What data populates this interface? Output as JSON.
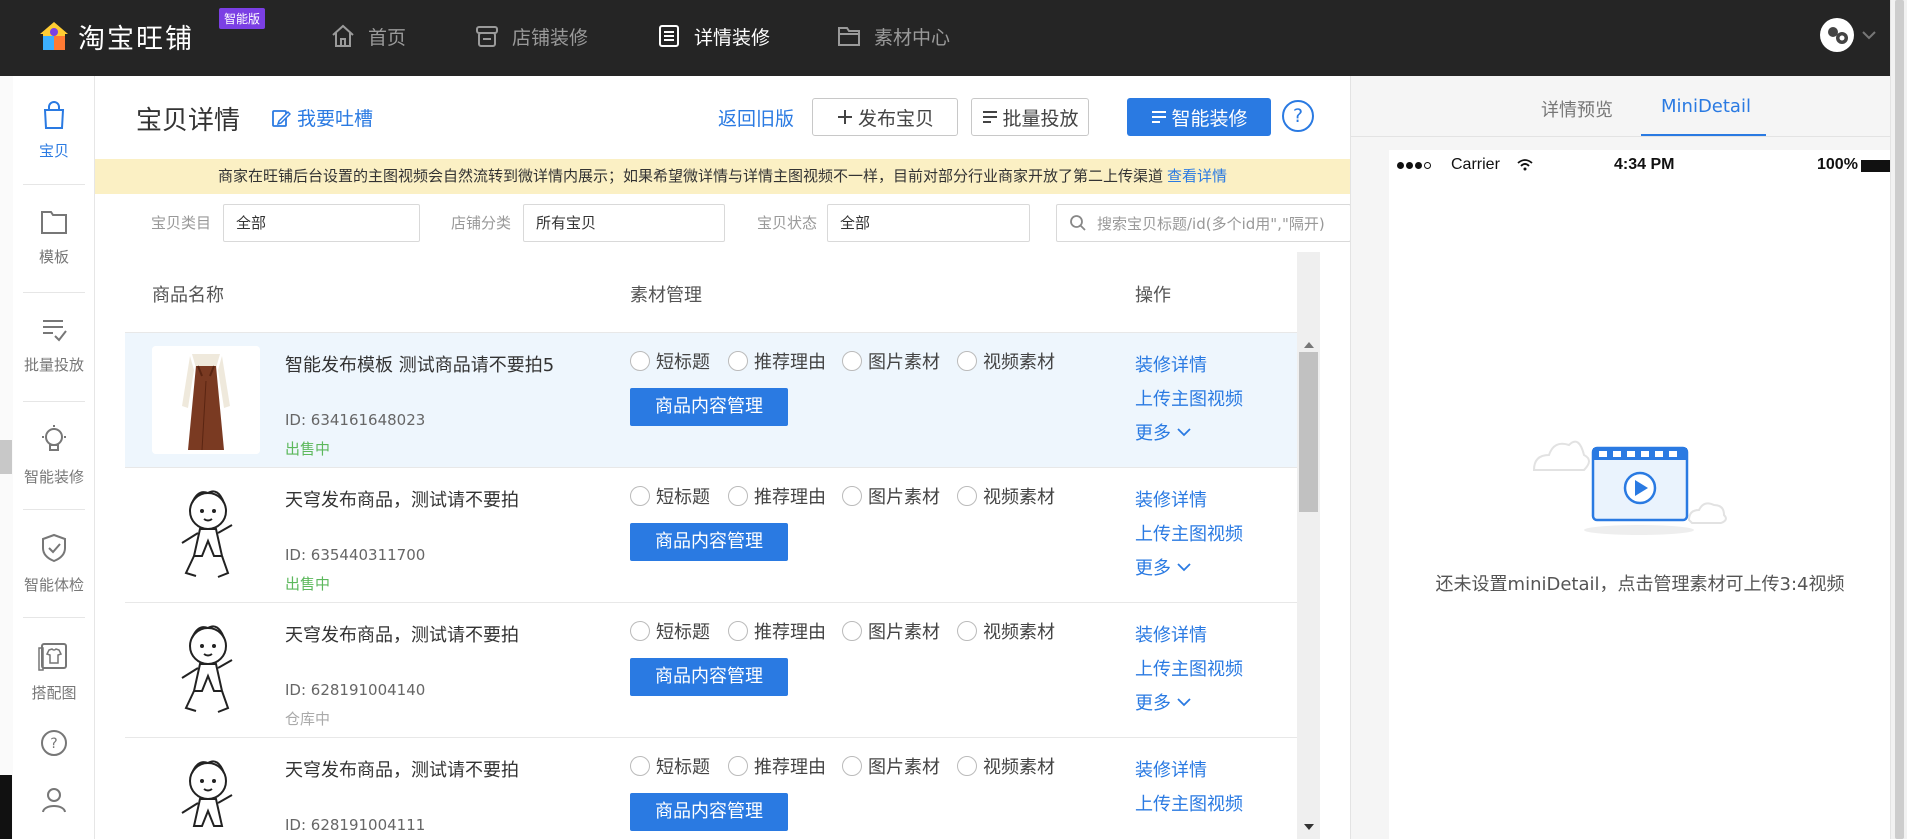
{
  "brand": {
    "logo_text": "淘宝旺铺",
    "badge": "智能版"
  },
  "topnav": [
    {
      "label": "首页",
      "icon": "home-icon"
    },
    {
      "label": "店铺装修",
      "icon": "store-icon"
    },
    {
      "label": "详情装修",
      "icon": "document-icon",
      "active": true
    },
    {
      "label": "素材中心",
      "icon": "folder-icon"
    }
  ],
  "sidebar": [
    {
      "label": "宝贝",
      "icon": "bag-icon",
      "active": true
    },
    {
      "label": "模板",
      "icon": "folder-icon"
    },
    {
      "label": "批量投放",
      "icon": "checklist-icon"
    },
    {
      "label": "智能装修",
      "icon": "lightbulb-icon"
    },
    {
      "label": "智能体检",
      "icon": "shield-check-icon"
    },
    {
      "label": "搭配图",
      "icon": "clothing-icon"
    },
    {
      "label": "",
      "icon": "help-icon"
    },
    {
      "label": "",
      "icon": "user-icon"
    }
  ],
  "header": {
    "title": "宝贝详情",
    "feedback": "我要吐槽",
    "back_old": "返回旧版",
    "publish": "发布宝贝",
    "batch": "批量投放",
    "smart": "智能装修",
    "help": "?"
  },
  "notice": {
    "text": "商家在旺铺后台设置的主图视频会自然流转到微详情内展示；如果希望微详情与详情主图视频不一样，目前对部分行业商家开放了第二上传渠道",
    "link": "查看详情"
  },
  "filters": {
    "category_label": "宝贝类目",
    "category_value": "全部",
    "shop_label": "店铺分类",
    "shop_value": "所有宝贝",
    "status_label": "宝贝状态",
    "status_value": "全部",
    "search_placeholder": "搜索宝贝标题/id(多个id用\",\"隔开)"
  },
  "table": {
    "headers": {
      "name": "商品名称",
      "material": "素材管理",
      "ops": "操作"
    },
    "material_options": [
      "短标题",
      "推荐理由",
      "图片素材",
      "视频素材"
    ],
    "content_btn": "商品内容管理",
    "op_labels": {
      "edit": "装修详情",
      "upload": "上传主图视频",
      "more": "更多"
    },
    "rows": [
      {
        "title": "智能发布模板 测试商品请不要拍5",
        "id": "ID: 634161648023",
        "status": "出售中",
        "image": "dress"
      },
      {
        "title": "天穹发布商品，测试请不要拍",
        "id": "ID: 635440311700",
        "status": "出售中",
        "image": "cartoon"
      },
      {
        "title": "天穹发布商品，测试请不要拍",
        "id": "ID: 628191004140",
        "status": "仓库中",
        "image": "cartoon"
      },
      {
        "title": "天穹发布商品，测试请不要拍",
        "id": "ID: 628191004111",
        "status": "",
        "image": "cartoon"
      }
    ]
  },
  "preview": {
    "tab_preview": "详情预览",
    "tab_mini": "MiniDetail",
    "phone_carrier": "Carrier",
    "phone_time": "4:34 PM",
    "phone_battery": "100%",
    "empty_text": "还未设置miniDetail，点击管理素材可上传3:4视频"
  },
  "colors": {
    "accent": "#2a7ae2",
    "topbar": "#252525",
    "notice_bg": "#fbf0c4",
    "on_sale": "#5cb85c",
    "badge": "#7b3fe4"
  }
}
